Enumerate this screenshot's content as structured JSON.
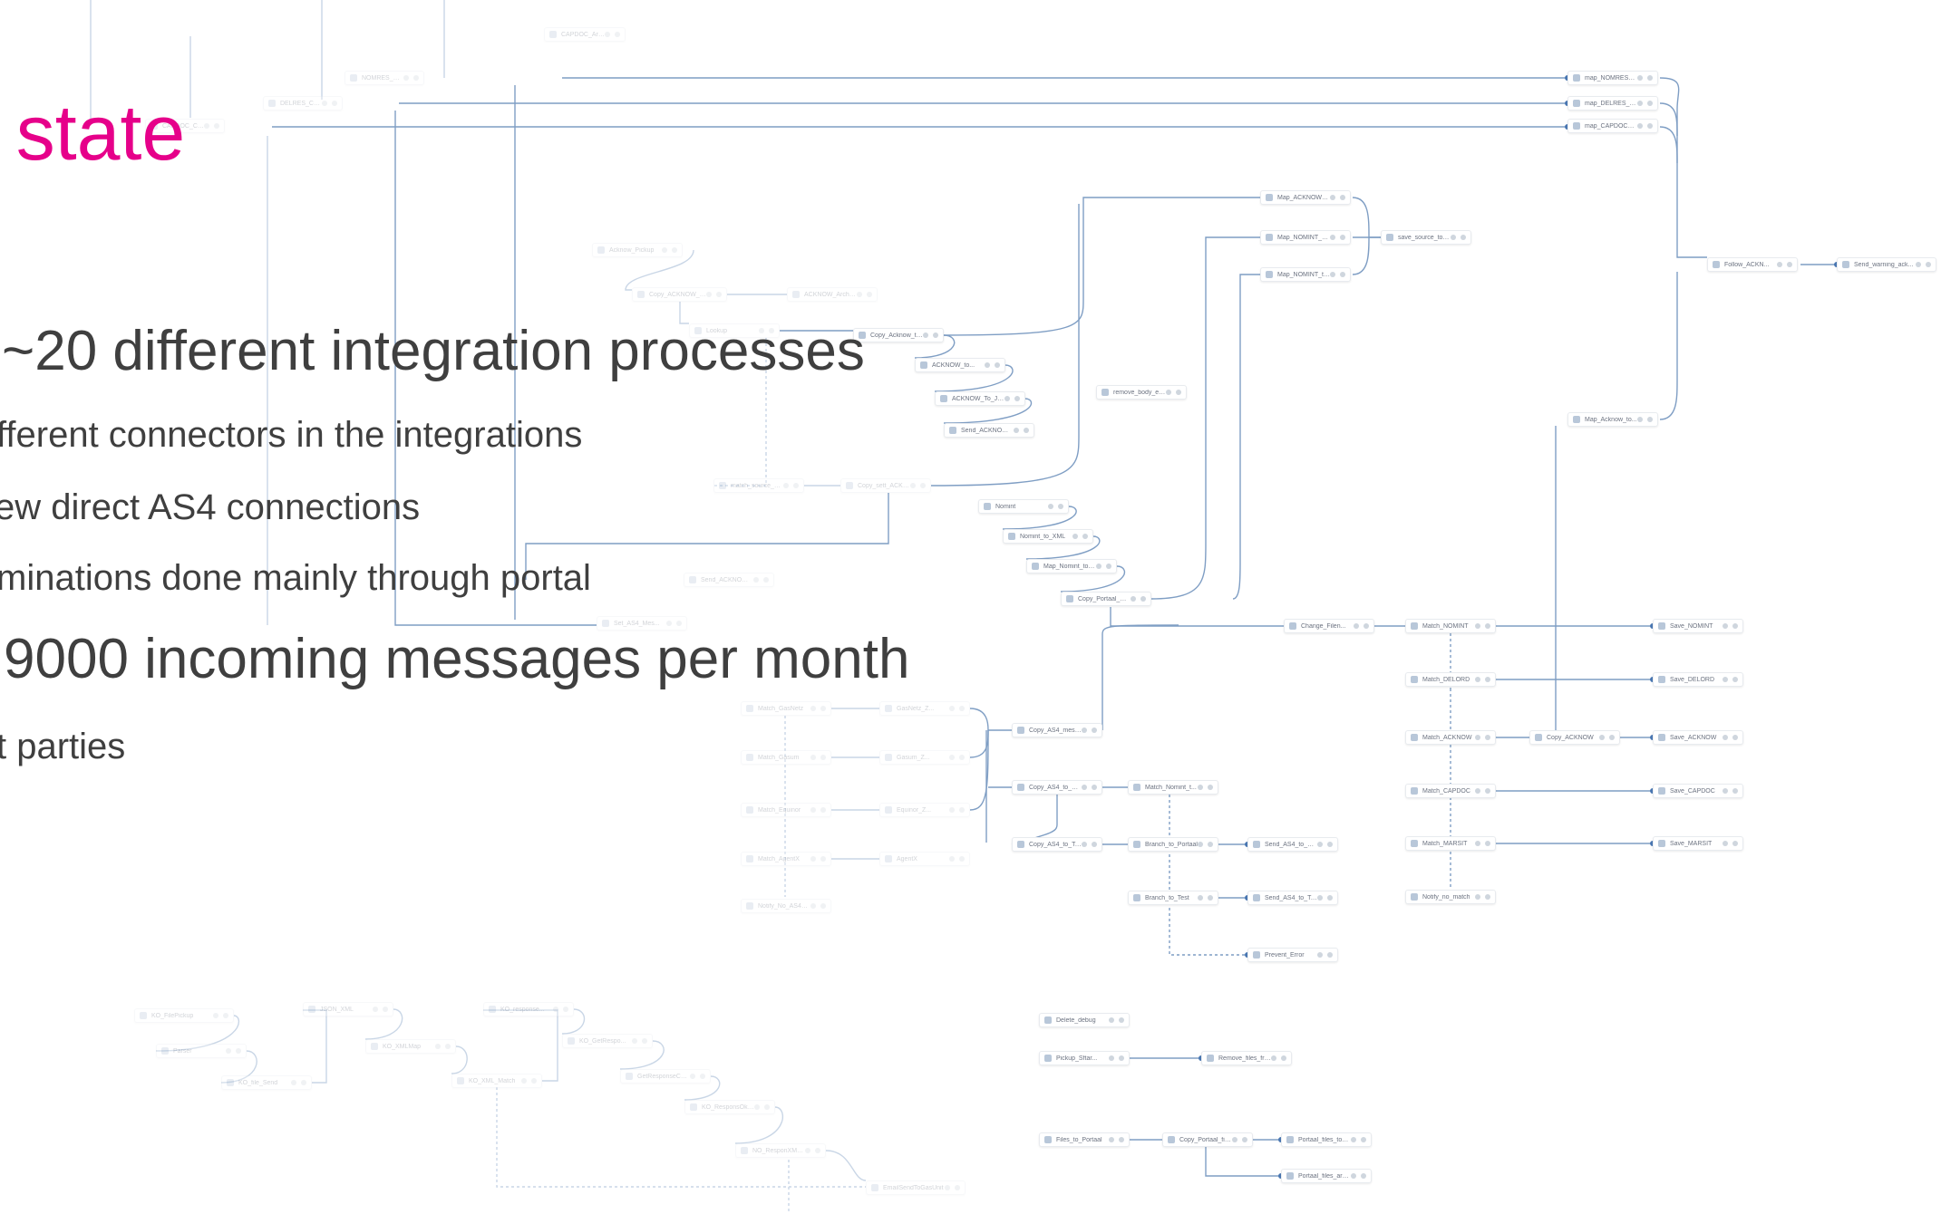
{
  "slide": {
    "title": "t state",
    "bullets": [
      {
        "text": "~20 different integration processes",
        "subs": [
          "fferent connectors in the integrations",
          "ew direct AS4 connections",
          "minations done mainly through portal"
        ]
      },
      {
        "text": "9000 incoming messages per month",
        "subs": [
          "t parties"
        ]
      }
    ]
  },
  "nodes": [
    {
      "id": "n1",
      "label": "NOMRES_Copy_D...",
      "faded": true
    },
    {
      "id": "n2",
      "label": "DELRES_Copy_D...",
      "faded": true
    },
    {
      "id": "n3",
      "label": "CAPDOC_Copy_B...",
      "faded": true
    },
    {
      "id": "n4",
      "label": "CAPDOC_Archive",
      "faded": true
    },
    {
      "id": "n5",
      "label": "map_NOMRES_to...",
      "faded": false
    },
    {
      "id": "n6",
      "label": "map_DELRES_To...",
      "faded": false
    },
    {
      "id": "n7",
      "label": "map_CAPDOC_To...",
      "faded": false
    },
    {
      "id": "n8",
      "label": "Map_ACKNOW_to...",
      "faded": false
    },
    {
      "id": "n9",
      "label": "Map_NOMINT_por...",
      "faded": false
    },
    {
      "id": "n10",
      "label": "Map_NOMINT_to...",
      "faded": false
    },
    {
      "id": "n11",
      "label": "save_source_to_d...",
      "faded": false
    },
    {
      "id": "n12",
      "label": "Follow_ACKN...",
      "faded": false
    },
    {
      "id": "n13",
      "label": "Send_warning_ack...",
      "faded": false
    },
    {
      "id": "n14",
      "label": "Acknow_Pickup",
      "faded": true
    },
    {
      "id": "n15",
      "label": "Copy_ACKNOW_t...",
      "faded": true
    },
    {
      "id": "n16",
      "label": "ACKNOW_Archive",
      "faded": true
    },
    {
      "id": "n17",
      "label": "Lookup",
      "faded": true
    },
    {
      "id": "n18",
      "label": "Copy_Acknow_to...",
      "faded": false
    },
    {
      "id": "n19",
      "label": "ACKNOW_to...",
      "faded": false
    },
    {
      "id": "n20",
      "label": "ACKNOW_To_JSON",
      "faded": false
    },
    {
      "id": "n21",
      "label": "Send_ACKNOW_t...",
      "faded": false
    },
    {
      "id": "n22",
      "label": "remove_body_ele...",
      "faded": false
    },
    {
      "id": "n23",
      "label": "match_source_sett",
      "faded": true
    },
    {
      "id": "n24",
      "label": "Copy_sett_ACKNOW",
      "faded": true
    },
    {
      "id": "n25",
      "label": "Map_Acknow_to...",
      "faded": false
    },
    {
      "id": "n26",
      "label": "Nomint",
      "faded": false
    },
    {
      "id": "n27",
      "label": "Nomint_to_XML",
      "faded": false
    },
    {
      "id": "n28",
      "label": "Map_Nomint_to_e...",
      "faded": false
    },
    {
      "id": "n29",
      "label": "Copy_Portaal_me...",
      "faded": false
    },
    {
      "id": "n30",
      "label": "Send_ACKNOW_t...",
      "faded": true
    },
    {
      "id": "n31",
      "label": "Set_AS4_Mes...",
      "faded": true
    },
    {
      "id": "n32",
      "label": "Change_Filen...",
      "faded": false
    },
    {
      "id": "n33",
      "label": "Match_NOMINT",
      "faded": false
    },
    {
      "id": "n34",
      "label": "Save_NOMINT",
      "faded": false
    },
    {
      "id": "n35",
      "label": "Match_DELORD",
      "faded": false
    },
    {
      "id": "n36",
      "label": "Save_DELORD",
      "faded": false
    },
    {
      "id": "n37",
      "label": "Match_ACKNOW",
      "faded": false
    },
    {
      "id": "n38",
      "label": "Copy_ACKNOW",
      "faded": false
    },
    {
      "id": "n39",
      "label": "Save_ACKNOW",
      "faded": false
    },
    {
      "id": "n40",
      "label": "Match_CAPDOC",
      "faded": false
    },
    {
      "id": "n41",
      "label": "Save_CAPDOC",
      "faded": false
    },
    {
      "id": "n42",
      "label": "Match_MARSIT",
      "faded": false
    },
    {
      "id": "n43",
      "label": "Save_MARSIT",
      "faded": false
    },
    {
      "id": "n44",
      "label": "Notify_no_match",
      "faded": false
    },
    {
      "id": "n45",
      "label": "Copy_AS4_message",
      "faded": false
    },
    {
      "id": "n46",
      "label": "Match_GasNetz",
      "faded": true
    },
    {
      "id": "n47",
      "label": "GasNetz_Z...",
      "faded": true
    },
    {
      "id": "n48",
      "label": "Match_Gasum",
      "faded": true
    },
    {
      "id": "n49",
      "label": "Gasum_Z...",
      "faded": true
    },
    {
      "id": "n50",
      "label": "Match_Equinor",
      "faded": true
    },
    {
      "id": "n51",
      "label": "Equinor_Z...",
      "faded": true
    },
    {
      "id": "n52",
      "label": "Match_AgentX",
      "faded": true
    },
    {
      "id": "n53",
      "label": "AgentX",
      "faded": true
    },
    {
      "id": "n54",
      "label": "Notify_No_AS4_P...",
      "faded": true
    },
    {
      "id": "n55",
      "label": "Copy_AS4_to_Port...",
      "faded": false
    },
    {
      "id": "n56",
      "label": "Match_Nomint_t...",
      "faded": false
    },
    {
      "id": "n57",
      "label": "Copy_AS4_to_Test",
      "faded": false
    },
    {
      "id": "n58",
      "label": "Branch_to_Portaal",
      "faded": false
    },
    {
      "id": "n59",
      "label": "Send_AS4_to_Port...",
      "faded": false
    },
    {
      "id": "n60",
      "label": "Branch_to_Test",
      "faded": false
    },
    {
      "id": "n61",
      "label": "Send_AS4_to_Test",
      "faded": false
    },
    {
      "id": "n62",
      "label": "Prevent_Error",
      "faded": false
    },
    {
      "id": "n63",
      "label": "Delete_debug",
      "faded": false
    },
    {
      "id": "n64",
      "label": "Pickup_Sftar...",
      "faded": false
    },
    {
      "id": "n65",
      "label": "Remove_files_from...",
      "faded": false
    },
    {
      "id": "n66",
      "label": "Files_to_Portaal",
      "faded": false
    },
    {
      "id": "n67",
      "label": "Copy_Portaal_file...",
      "faded": false
    },
    {
      "id": "n68",
      "label": "Portaal_files_to_S3",
      "faded": false
    },
    {
      "id": "n69",
      "label": "Portaal_files_archive",
      "faded": false
    },
    {
      "id": "n70",
      "label": "KO_FilePickup",
      "faded": true
    },
    {
      "id": "n71",
      "label": "Parser",
      "faded": true
    },
    {
      "id": "n72",
      "label": "KO_file_Send",
      "faded": true
    },
    {
      "id": "n73",
      "label": "JSON_XML",
      "faded": true
    },
    {
      "id": "n74",
      "label": "KO_XMLMap",
      "faded": true
    },
    {
      "id": "n75",
      "label": "KO_XML_Match",
      "faded": true
    },
    {
      "id": "n76",
      "label": "KO_response...",
      "faded": true
    },
    {
      "id": "n77",
      "label": "KO_GetRespo...",
      "faded": true
    },
    {
      "id": "n78",
      "label": "GetResponseCopy",
      "faded": true
    },
    {
      "id": "n79",
      "label": "KO_ResponsOkOk...",
      "faded": true
    },
    {
      "id": "n80",
      "label": "NO_ResponXML...",
      "faded": true
    },
    {
      "id": "n81",
      "label": "EmailSendToGasUnit",
      "faded": true
    }
  ]
}
